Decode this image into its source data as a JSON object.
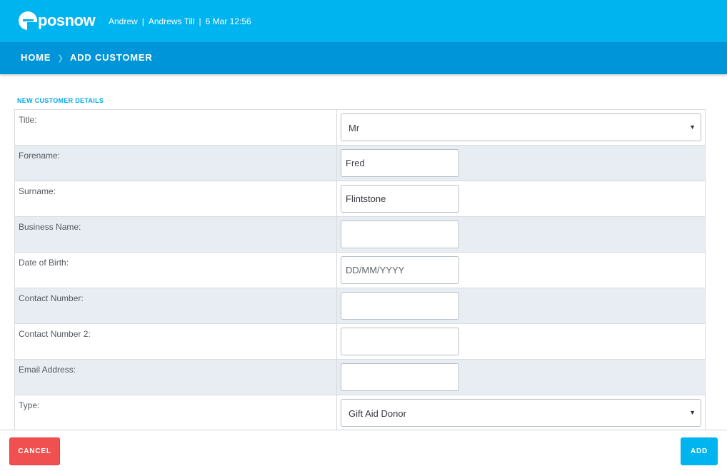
{
  "header": {
    "logo_text": "posnow",
    "user": "Andrew",
    "till": "Andrews Till",
    "datetime": "6 Mar 12:56",
    "separator": "|"
  },
  "breadcrumb": {
    "home": "HOME",
    "current": "ADD CUSTOMER"
  },
  "form": {
    "section_title": "NEW CUSTOMER DETAILS",
    "title": {
      "label": "Title:",
      "value": "Mr"
    },
    "forename": {
      "label": "Forename:",
      "value": "Fred"
    },
    "surname": {
      "label": "Surname:",
      "value": "Flintstone"
    },
    "business_name": {
      "label": "Business Name:",
      "value": ""
    },
    "dob": {
      "label": "Date of Birth:",
      "value": "",
      "placeholder": "DD/MM/YYYY"
    },
    "contact_number": {
      "label": "Contact Number:",
      "value": ""
    },
    "contact_number_2": {
      "label": "Contact Number 2:",
      "value": ""
    },
    "email": {
      "label": "Email Address:",
      "value": ""
    },
    "type": {
      "label": "Type:",
      "value": "Gift Aid Donor"
    }
  },
  "footer": {
    "cancel_label": "CANCEL",
    "add_label": "ADD"
  },
  "colors": {
    "header_bg": "#00b4f0",
    "breadcrumb_bg": "#0095d8",
    "cancel_bg": "#f05050",
    "add_bg": "#00b4f0",
    "alt_row_bg": "#e8edf3"
  },
  "icons": {
    "logo": "eposnow-logo",
    "breadcrumb_separator": "chevron-right-icon",
    "select_arrow": "caret-down-icon"
  }
}
